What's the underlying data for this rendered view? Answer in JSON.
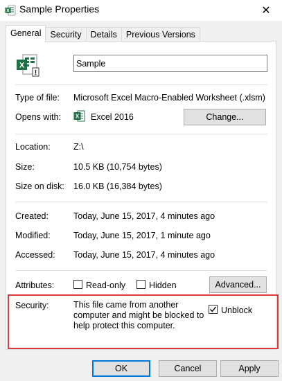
{
  "window": {
    "title": "Sample Properties",
    "close_glyph": "✕",
    "title_icon": "excel-file-icon"
  },
  "tabs": [
    {
      "label": "General",
      "active": true
    },
    {
      "label": "Security",
      "active": false
    },
    {
      "label": "Details",
      "active": false
    },
    {
      "label": "Previous Versions",
      "active": false
    }
  ],
  "general": {
    "file_name": "Sample",
    "type_of_file": {
      "label": "Type of file:",
      "value": "Microsoft Excel Macro-Enabled Worksheet (.xlsm)"
    },
    "opens_with": {
      "label": "Opens with:",
      "value": "Excel 2016",
      "icon": "excel-app-icon",
      "change_label": "Change..."
    },
    "location": {
      "label": "Location:",
      "value": "Z:\\"
    },
    "size": {
      "label": "Size:",
      "value": "10.5 KB (10,754 bytes)"
    },
    "size_on_disk": {
      "label": "Size on disk:",
      "value": "16.0 KB (16,384 bytes)"
    },
    "created": {
      "label": "Created:",
      "value": "Today, June 15, 2017, 4 minutes ago"
    },
    "modified": {
      "label": "Modified:",
      "value": "Today, June 15, 2017, 1 minute ago"
    },
    "accessed": {
      "label": "Accessed:",
      "value": "Today, June 15, 2017, 4 minutes ago"
    },
    "attributes": {
      "label": "Attributes:",
      "readonly_label": "Read-only",
      "readonly_checked": false,
      "hidden_label": "Hidden",
      "hidden_checked": false,
      "advanced_label": "Advanced..."
    },
    "security": {
      "label": "Security:",
      "message": "This file came from another computer and might be blocked to help protect this computer.",
      "unblock_label": "Unblock",
      "unblock_checked": true,
      "highlight_color": "#e0393b"
    }
  },
  "footer": {
    "ok_label": "OK",
    "cancel_label": "Cancel",
    "apply_label": "Apply"
  },
  "colors": {
    "excel_green": "#1e7145",
    "accent_blue": "#0078d7"
  }
}
